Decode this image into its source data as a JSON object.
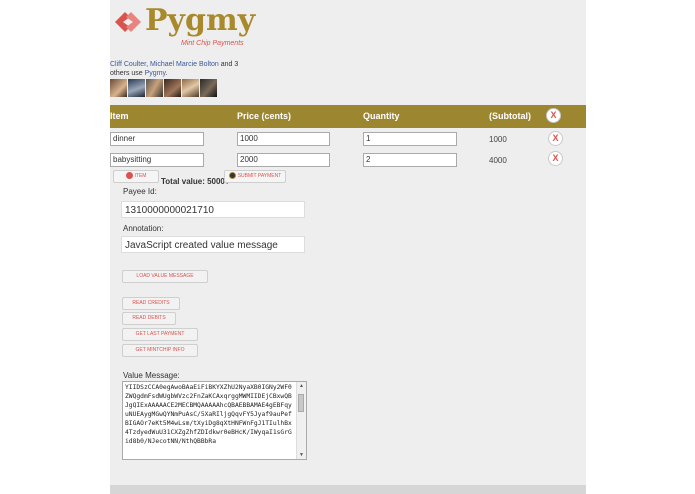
{
  "brand": {
    "name": "Pygmy",
    "tagline": "Mint Chip Payments",
    "color": "#a8892b",
    "accent": "#d9534f"
  },
  "social": {
    "friend1": "Cliff Coulter",
    "sep": ", ",
    "friend2": "Michael Marcie Bolton",
    "and_text": " and 3 others use ",
    "app_link": "Pygmy",
    "end": "."
  },
  "table": {
    "headers": [
      "Item",
      "Price (cents)",
      "Quantity",
      "(Subtotal)"
    ],
    "rows": [
      {
        "item": "dinner",
        "price": "1000",
        "quantity": "1",
        "subtotal": "1000"
      },
      {
        "item": "babysitting",
        "price": "2000",
        "quantity": "2",
        "subtotal": "4000"
      }
    ],
    "remove_glyph": "X"
  },
  "toolbar": {
    "add_item_label": "ITEM",
    "total_label": "Total value: 5000¢",
    "submit_label": "SUBMIT PAYMENT"
  },
  "form": {
    "payee_label": "Payee Id:",
    "payee_value": "1310000000021710",
    "annotation_label": "Annotation:",
    "annotation_value": "JavaScript created value message"
  },
  "actions": {
    "load": "LOAD VALUE MESSAGE",
    "read_credits": "READ CREDITS",
    "read_debits": "READ DEBITS",
    "get_last_payment": "GET LAST PAYMENT",
    "get_mintchip_info": "GET MINTCHIP INFO"
  },
  "value_message": {
    "label": "Value Message:",
    "text": "YIIDSzCCA0egAwoBAaEiFiBKYXZhU2NyaXB0IGNy2WF0ZWQgdmFsdWUgbWVzc2FnZaKCAxqrggMWMIIDEjCBxwQBJgQIExAAAAACE2MECBMQAAAAAhcQBAEBBAMAE4gEBFqyuNUEAygMGwQYNmPuAsC/5XaRIljgQqvFY5Jyaf9auPefBIGAOr7eKt5M4wLsm/tXyiDg8qXtHNFWnFgJ1TIulhBx4TzdyedWuU31CXZgZhfZDIdkwr0eBHcK/IWyqaI1sGrGid8b0/NJecotNN/NthQBBbRa"
  }
}
